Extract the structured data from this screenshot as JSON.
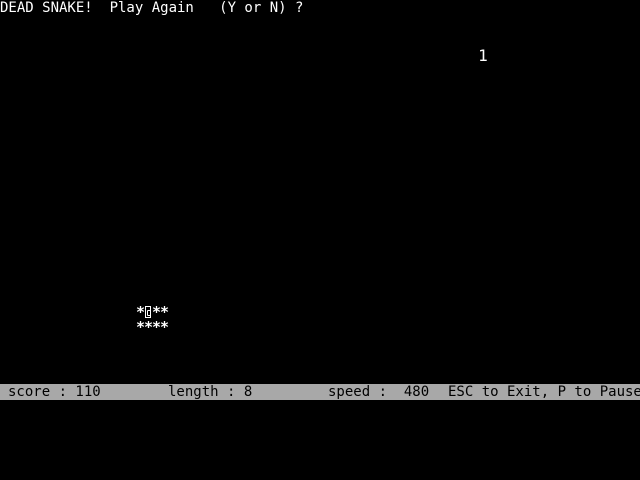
{
  "message": {
    "prompt": "DEAD SNAKE!  Play Again   (Y or N) ?"
  },
  "board": {
    "food_value": "1",
    "snake": {
      "segment_glyph": "*",
      "segment_count": 8,
      "head_icon": "snake-head-icon"
    }
  },
  "status_bar": {
    "score": "score : 110",
    "length": "length : 8",
    "speed": "speed :  480",
    "help": "ESC to Exit, P to Pause"
  },
  "colors": {
    "background": "#000000",
    "foreground": "#ffffff",
    "status_bar_bg": "#a8a8a8",
    "status_bar_fg": "#000000"
  }
}
